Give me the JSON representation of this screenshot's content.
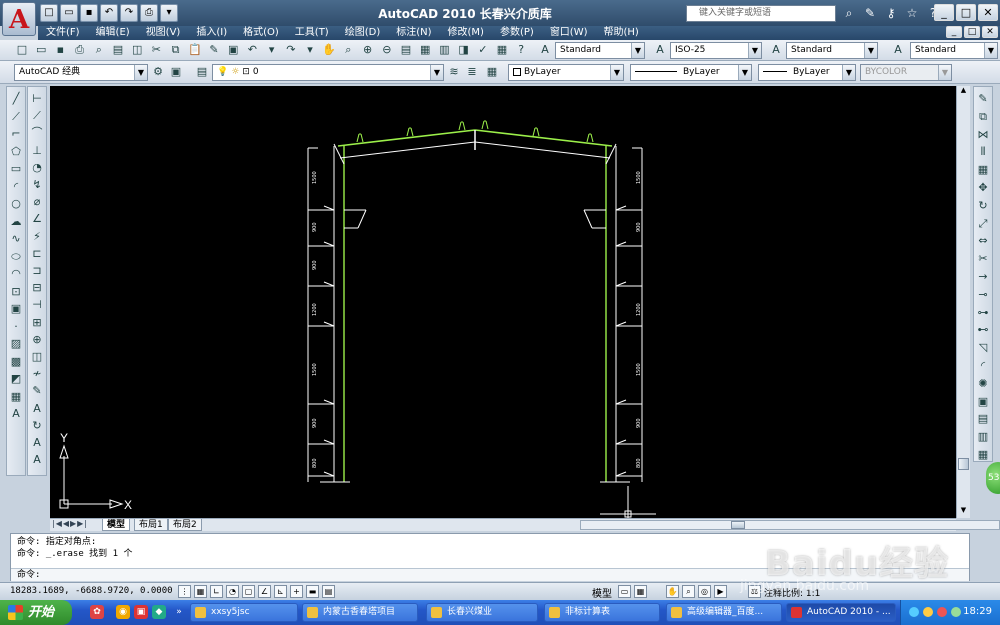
{
  "window": {
    "app_title": "AutoCAD 2010  长春兴介质库",
    "search_placeholder": "键入关键字或短语",
    "min": "_",
    "restore": "□",
    "close": "✕"
  },
  "menubar": [
    "文件(F)",
    "编辑(E)",
    "视图(V)",
    "插入(I)",
    "格式(O)",
    "工具(T)",
    "绘图(D)",
    "标注(N)",
    "修改(M)",
    "参数(P)",
    "窗口(W)",
    "帮助(H)"
  ],
  "toolbar1": {
    "text_style": "Standard",
    "dim_style": "ISO-25",
    "table_style": "Standard",
    "mleader_style": "Standard"
  },
  "toolbar2": {
    "workspace": "AutoCAD 经典",
    "layer": "0",
    "color": "ByLayer",
    "linetype": "ByLayer",
    "lineweight": "ByLayer",
    "plotstyle": "BYCOLOR"
  },
  "ucs": {
    "x_label": "X",
    "y_label": "Y"
  },
  "drawing": {
    "left_dims": [
      "1500",
      "900",
      "900",
      "1200",
      "1500",
      "900",
      "800"
    ],
    "right_dims": [
      "1500",
      "900",
      "1200",
      "1500",
      "900",
      "800"
    ]
  },
  "layout_tabs": [
    "模型",
    "布局1",
    "布局2"
  ],
  "command_line": {
    "line1": "命令: 指定对角点:",
    "line2": "命令: _.erase 找到 1 个",
    "prompt": "命令:"
  },
  "status": {
    "coords": "18283.1689, -6688.9720, 0.0000",
    "model_label": "模型",
    "annotation_scale": "注释比例: 1:1"
  },
  "watermark": {
    "brand": "Baidu经验",
    "url": "jingyan.baidu.com"
  },
  "green_badge": "53",
  "taskbar": {
    "start": "开始",
    "tasks": [
      "xxsy5jsc",
      "内蒙古香春塔项目",
      "长春兴煤业",
      "非标计算表",
      "高级编辑器_百度...",
      "AutoCAD 2010 - ..."
    ],
    "clock": "18:29"
  },
  "colors": {
    "canvas": "#000000",
    "frame": "#ffffff",
    "green": "#9cf04a",
    "taskbar": "#2457c8"
  }
}
